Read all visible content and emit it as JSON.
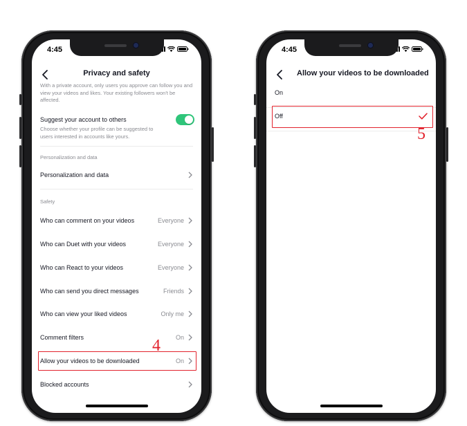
{
  "colors": {
    "accent_red": "#e2222c",
    "toggle_green": "#2fc57a",
    "text": "#161823",
    "secondary_text": "#8a8b91"
  },
  "phone1": {
    "status_time": "4:45",
    "title": "Privacy and safety",
    "private_account_desc": "With a private account, only users you approve can follow you and view your videos and likes. Your existing followers won't be affected.",
    "suggest": {
      "label": "Suggest your account to others",
      "desc": "Choose whether your profile can be suggested to users interested in accounts like yours.",
      "toggle_on": true
    },
    "personalization_header": "Personalization and data",
    "personalization_item": "Personalization and data",
    "safety_header": "Safety",
    "safety_items": [
      {
        "label": "Who can comment on your videos",
        "value": "Everyone"
      },
      {
        "label": "Who can Duet with your videos",
        "value": "Everyone"
      },
      {
        "label": "Who can React to your videos",
        "value": "Everyone"
      },
      {
        "label": "Who can send you direct messages",
        "value": "Friends"
      },
      {
        "label": "Who can view your liked videos",
        "value": "Only me"
      },
      {
        "label": "Comment filters",
        "value": "On"
      },
      {
        "label": "Allow your videos to be downloaded",
        "value": "On"
      },
      {
        "label": "Blocked accounts",
        "value": ""
      }
    ],
    "step_label": "4"
  },
  "phone2": {
    "status_time": "4:45",
    "title": "Allow your videos to be downloaded",
    "options": [
      {
        "label": "On",
        "selected": false
      },
      {
        "label": "Off",
        "selected": true
      }
    ],
    "step_label": "5"
  },
  "icons": [
    "back-arrow-icon",
    "chevron-right-icon",
    "checkmark-icon",
    "signal-icon",
    "wifi-icon",
    "battery-icon"
  ]
}
